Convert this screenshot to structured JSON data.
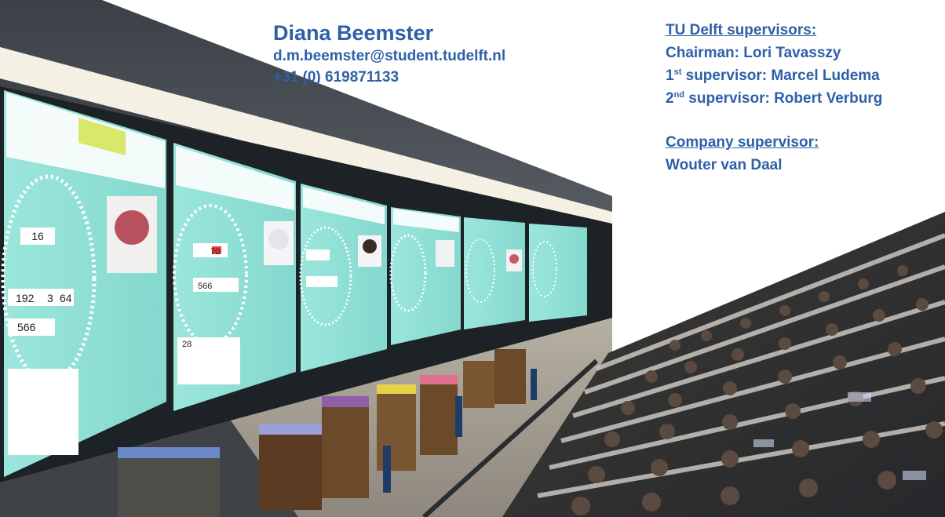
{
  "contact": {
    "name": "Diana Beemster",
    "email": "d.m.beemster@student.tudelft.nl",
    "phone": "+31 (0) 619871133"
  },
  "supervisors": {
    "tu_heading": "TU Delft supervisors:",
    "chairman": "Chairman: Lori Tavasszy",
    "first_ordinal": "1",
    "first_suffix": "st",
    "first_rest": " supervisor: Marcel Ludema",
    "second_ordinal": "2",
    "second_suffix": "nd",
    "second_rest": " supervisor: Robert Verburg",
    "company_heading": "Company supervisor:",
    "company_name": "Wouter van Daal"
  },
  "screens": [
    {
      "lot": "16",
      "price": "566",
      "bids": [
        "192",
        "3",
        "64"
      ]
    },
    {
      "lot": "70",
      "price": "566",
      "bids": [
        "28"
      ]
    },
    {
      "lot": "",
      "price": "",
      "bids": []
    },
    {
      "lot": "",
      "price": "",
      "bids": []
    },
    {
      "lot": "",
      "price": "",
      "bids": []
    },
    {
      "lot": "",
      "price": "",
      "bids": []
    }
  ],
  "colors": {
    "text_blue": "#2e5fa8",
    "screen_teal": "#8fe0d6",
    "frame_dark": "#1d2226"
  }
}
